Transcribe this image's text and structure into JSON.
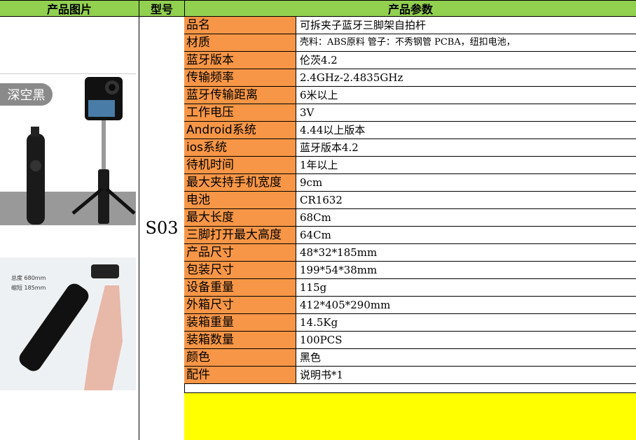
{
  "header": {
    "col1": "产品图片",
    "col2": "型号",
    "col3": "产品参数"
  },
  "model": "S03",
  "image": {
    "badge": "深空黑",
    "total_length": "总度 680mm",
    "folded_length": "缩短 185mm"
  },
  "params": [
    {
      "key": "品名",
      "value": "可拆夹子蓝牙三脚架自拍杆"
    },
    {
      "key": "材质",
      "value": "壳料：ABS原料  管子：不秀钢管  PCBA，纽扣电池，",
      "small": true
    },
    {
      "key": "蓝牙版本",
      "value": "伦茨4.2"
    },
    {
      "key": "传输频率",
      "value": "2.4GHz-2.4835GHz"
    },
    {
      "key": "蓝牙传输距离",
      "value": "6米以上"
    },
    {
      "key": "工作电压",
      "value": "3V"
    },
    {
      "key": "Android系统",
      "value": "4.44以上版本"
    },
    {
      "key": "ios系统",
      "value": "蓝牙版本4.2"
    },
    {
      "key": "待机时间",
      "value": "1年以上"
    },
    {
      "key": "最大夹持手机宽度",
      "value": "9cm"
    },
    {
      "key": "电池",
      "value": "CR1632"
    },
    {
      "key": "最大长度",
      "value": "68Cm"
    },
    {
      "key": "三脚打开最大高度",
      "value": "64Cm"
    },
    {
      "key": "产品尺寸",
      "value": "48*32*185mm"
    },
    {
      "key": "包装尺寸",
      "value": "199*54*38mm"
    },
    {
      "key": "设备重量",
      "value": "115g"
    },
    {
      "key": "外箱尺寸",
      "value": "412*405*290mm"
    },
    {
      "key": "装箱重量",
      "value": "14.5Kg"
    },
    {
      "key": "装箱数量",
      "value": "100PCS"
    },
    {
      "key": "颜色",
      "value": "黑色"
    },
    {
      "key": "配件",
      "value": "说明书*1"
    }
  ]
}
